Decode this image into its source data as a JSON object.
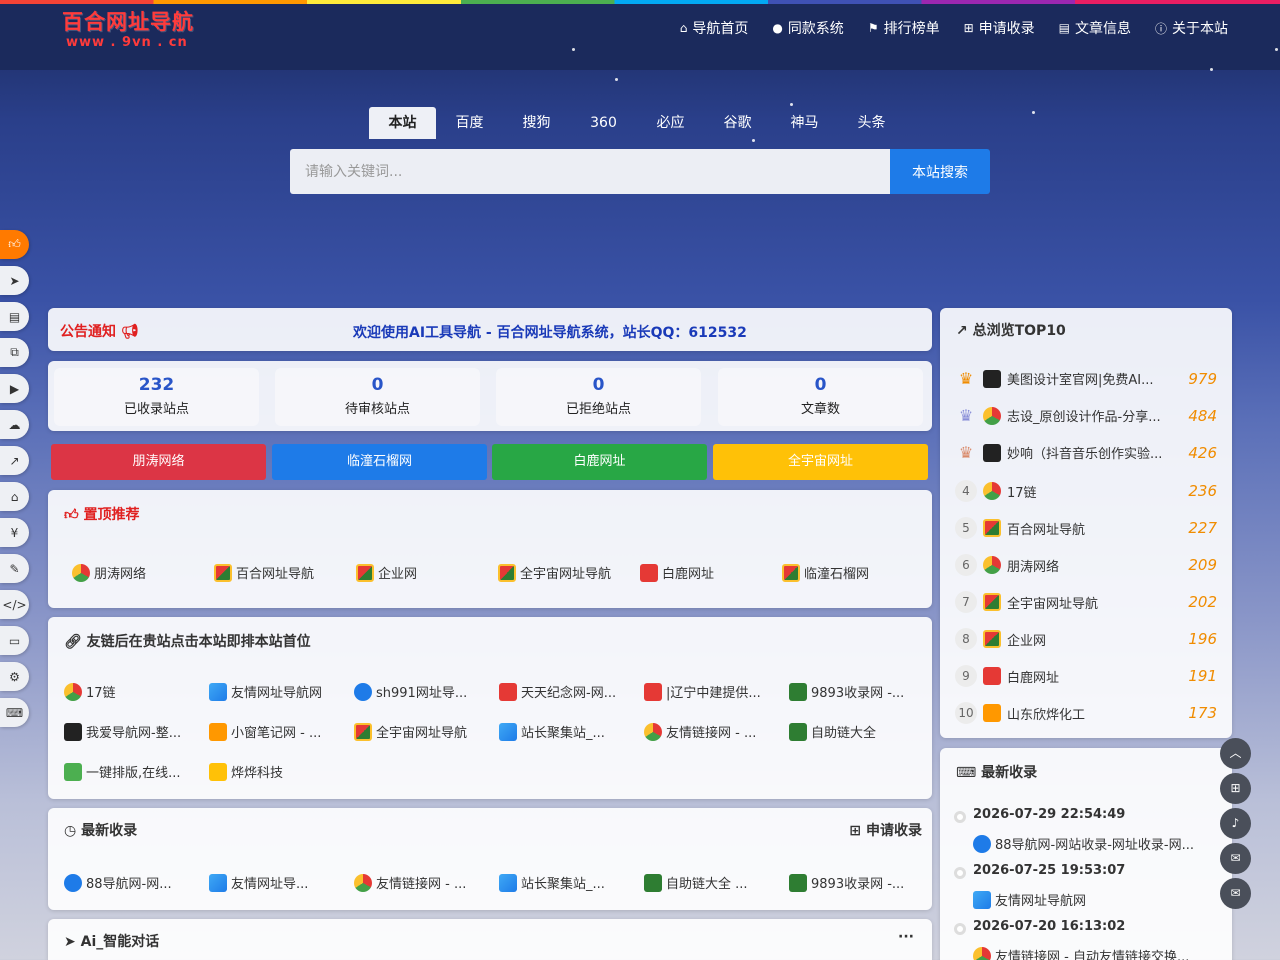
{
  "logo": {
    "title": "百合网址导航",
    "domain": "www . 9vn . cn"
  },
  "nav": [
    {
      "icon": "home-icon",
      "glyph": "⌂",
      "label": "导航首页"
    },
    {
      "icon": "circle-arrow-icon",
      "glyph": "●",
      "label": "同款系统"
    },
    {
      "icon": "flag-icon",
      "glyph": "⚑",
      "label": "排行榜单"
    },
    {
      "icon": "plus-square-icon",
      "glyph": "⊞",
      "label": "申请收录"
    },
    {
      "icon": "book-icon",
      "glyph": "▤",
      "label": "文章信息"
    },
    {
      "icon": "info-icon",
      "glyph": "ⓘ",
      "label": "关于本站"
    }
  ],
  "search": {
    "tabs": [
      "本站",
      "百度",
      "搜狗",
      "360",
      "必应",
      "谷歌",
      "神马",
      "头条"
    ],
    "active": "本站",
    "placeholder": "请输入关键词...",
    "button": "本站搜索"
  },
  "notice": {
    "label": "公告通知",
    "message": "欢迎使用AI工具导航 - 百合网址导航系统，站长QQ：612532"
  },
  "stats": [
    {
      "value": "232",
      "label": "已收录站点"
    },
    {
      "value": "0",
      "label": "待审核站点"
    },
    {
      "value": "0",
      "label": "已拒绝站点"
    },
    {
      "value": "0",
      "label": "文章数"
    }
  ],
  "color_buttons": [
    {
      "label": "朋涛网络",
      "color": "#dc3545"
    },
    {
      "label": "临潼石榴网",
      "color": "#1e7be8"
    },
    {
      "label": "白鹿网址",
      "color": "#28a745"
    },
    {
      "label": "全宇宙网址",
      "color": "#ffc107"
    }
  ],
  "top_recommend": {
    "title": "置顶推荐",
    "sites": [
      "朋涛网络",
      "百合网址导航",
      "企业网",
      "全宇宙网址导航",
      "白鹿网址",
      "临潼石榴网"
    ]
  },
  "friend_links": {
    "title": "友链后在贵站点击本站即排本站首位",
    "sites": [
      "17链",
      "友情网址导航网",
      "sh991网址导...",
      "天天纪念网-网...",
      "|辽宁中建提供...",
      "9893收录网 -...",
      "我爱导航网-整...",
      "小窗笔记网 - ...",
      "全宇宙网址导航",
      "站长聚集站_...",
      "友情链接网 - ...",
      "自助链大全",
      "一键排版,在线...",
      "烨烨科技"
    ]
  },
  "latest": {
    "title": "最新收录",
    "apply": "申请收录",
    "sites": [
      "88导航网-网...",
      "友情网址导...",
      "友情链接网 - ...",
      "站长聚集站_...",
      "自助链大全 ...",
      "9893收录网 -..."
    ]
  },
  "ai_chat": {
    "title": "Ai_智能对话",
    "more": "···"
  },
  "top10": {
    "title": "总浏览TOP10",
    "items": [
      {
        "name": "美图设计室官网|免费AI...",
        "count": "979"
      },
      {
        "name": "志设_原创设计作品-分享...",
        "count": "484"
      },
      {
        "name": "妙响（抖音音乐创作实验...",
        "count": "426"
      },
      {
        "name": "17链",
        "count": "236"
      },
      {
        "name": "百合网址导航",
        "count": "227"
      },
      {
        "name": "朋涛网络",
        "count": "209"
      },
      {
        "name": "全宇宙网址导航",
        "count": "202"
      },
      {
        "name": "企业网",
        "count": "196"
      },
      {
        "name": "白鹿网址",
        "count": "191"
      },
      {
        "name": "山东欣烨化工",
        "count": "173"
      }
    ]
  },
  "recent": {
    "title": "最新收录",
    "items": [
      {
        "date": "2026-07-29 22:54:49",
        "name": "88导航网-网站收录-网址收录-网..."
      },
      {
        "date": "2026-07-25 19:53:07",
        "name": "友情网址导航网"
      },
      {
        "date": "2026-07-20 16:13:02",
        "name": "友情链接网 - 自动友情链接交换..."
      }
    ]
  }
}
